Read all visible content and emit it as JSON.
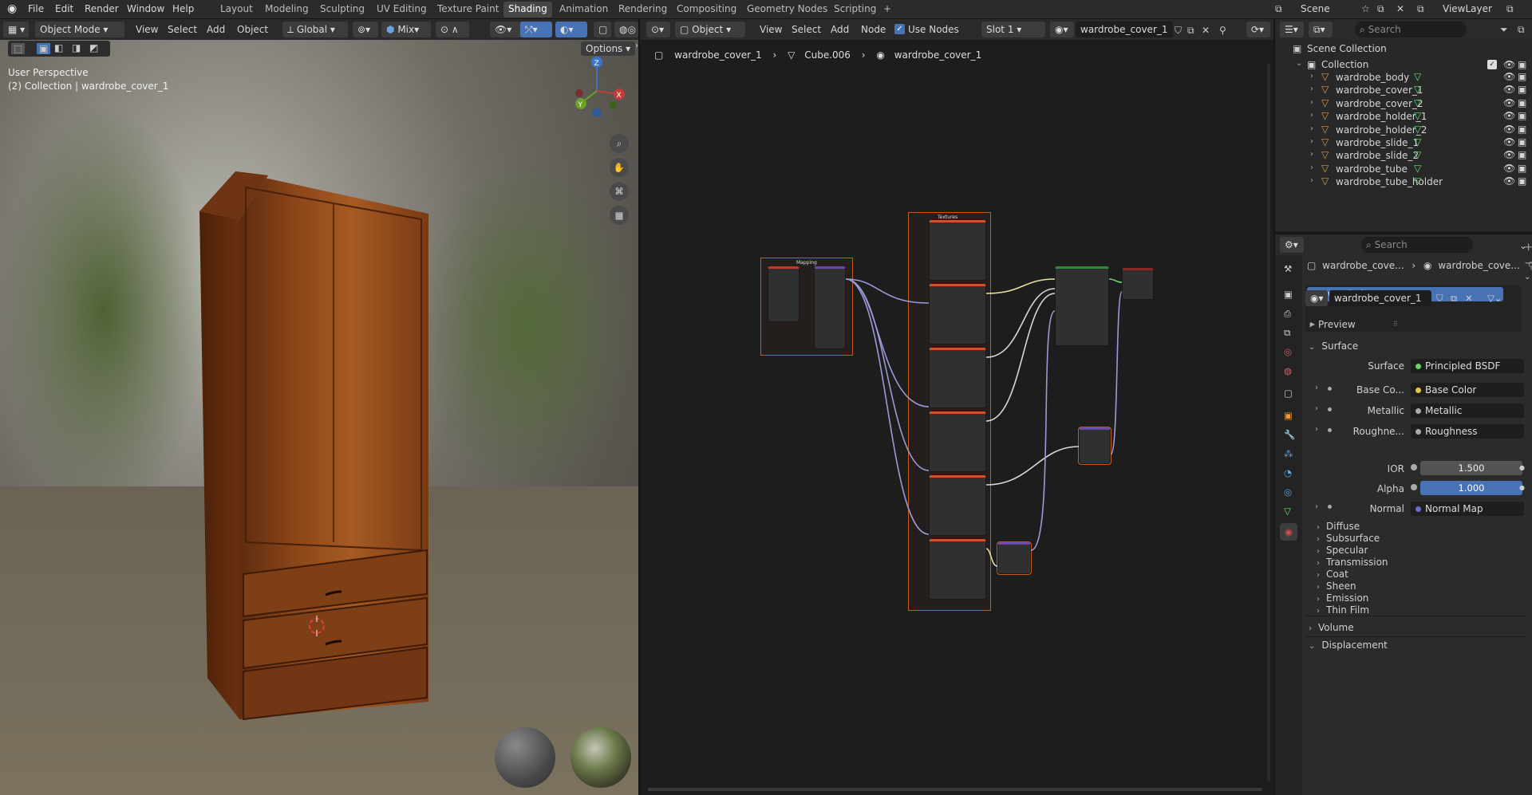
{
  "menu": [
    "File",
    "Edit",
    "Render",
    "Window",
    "Help"
  ],
  "workspaces": [
    "Layout",
    "Modeling",
    "Sculpting",
    "UV Editing",
    "Texture Paint",
    "Shading",
    "Animation",
    "Rendering",
    "Compositing",
    "Geometry Nodes",
    "Scripting"
  ],
  "active_workspace": "Shading",
  "plus": "+",
  "scene": "Scene",
  "view_layer": "ViewLayer",
  "viewport": {
    "mode": "Object Mode",
    "view": "View",
    "select": "Select",
    "add": "Add",
    "object": "Object",
    "orientation": "Global",
    "snap_mix": "Mix",
    "options": "Options",
    "info_line1": "User Perspective",
    "info_line2": "(2) Collection | wardrobe_cover_1",
    "gizmo_z": "Z",
    "gizmo_x": "X",
    "gizmo_y": "Y"
  },
  "node_editor": {
    "type": "Object",
    "view": "View",
    "select": "Select",
    "add": "Add",
    "node": "Node",
    "use_nodes": "Use Nodes",
    "slot": "Slot 1",
    "material": "wardrobe_cover_1",
    "breadcrumb": [
      "wardrobe_cover_1",
      "Cube.006",
      "wardrobe_cover_1"
    ],
    "frame_textures": "Textures",
    "frame_mapping": "Mapping"
  },
  "outliner": {
    "search_placeholder": "Search",
    "scene_collection": "Scene Collection",
    "collection": "Collection",
    "items": [
      "wardrobe_body",
      "wardrobe_cover_1",
      "wardrobe_cover_2",
      "wardrobe_holder_1",
      "wardrobe_holder_2",
      "wardrobe_slide_1",
      "wardrobe_slide_2",
      "wardrobe_tube",
      "wardrobe_tube_holder"
    ]
  },
  "properties": {
    "search_placeholder": "Search",
    "crumb_object": "wardrobe_cove...",
    "crumb_material": "wardrobe_cove...",
    "slot_name": "wardrobe_cover_1",
    "material_name": "wardrobe_cover_1",
    "preview": "Preview",
    "surface": "Surface",
    "surface_label": "Surface",
    "surface_value": "Principled BSDF",
    "rows": [
      {
        "label": "Base Co...",
        "value": "Base Color"
      },
      {
        "label": "Metallic",
        "value": "Metallic"
      },
      {
        "label": "Roughne...",
        "value": "Roughness"
      }
    ],
    "ior_label": "IOR",
    "ior_value": "1.500",
    "alpha_label": "Alpha",
    "alpha_value": "1.000",
    "normal_label": "Normal",
    "normal_value": "Normal Map",
    "subsections": [
      "Diffuse",
      "Subsurface",
      "Specular",
      "Transmission",
      "Coat",
      "Sheen",
      "Emission",
      "Thin Film"
    ],
    "volume": "Volume",
    "displacement": "Displacement"
  },
  "colors": {
    "accent": "#4772b3",
    "active_tab": "#474747",
    "frame": "#c55a1a"
  }
}
